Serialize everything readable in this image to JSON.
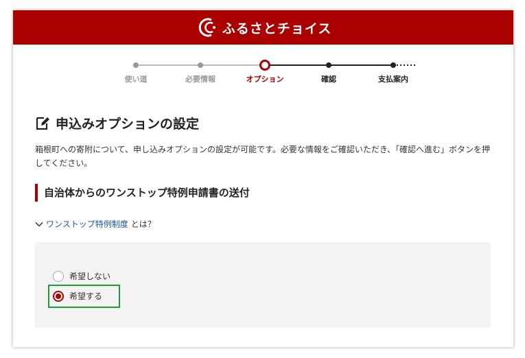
{
  "header": {
    "brand": "ふるさとチョイス",
    "bg_color": "#aa0000"
  },
  "steps": {
    "items": [
      {
        "label": "使い道",
        "state": "done"
      },
      {
        "label": "必要情報",
        "state": "done"
      },
      {
        "label": "オプション",
        "state": "current"
      },
      {
        "label": "確認",
        "state": "upcoming"
      },
      {
        "label": "支払案内",
        "state": "upcoming"
      }
    ]
  },
  "page": {
    "title": "申込みオプションの設定",
    "description": "箱根町への寄附について、申し込みオプションの設定が可能です。必要な情報をご確認いただき、「確認へ進む」ボタンを押してください。"
  },
  "section": {
    "title": "自治体からのワンストップ特例申請書の送付",
    "onestop_link": "ワンストップ特例制度",
    "onestop_suffix": "とは？"
  },
  "options": [
    {
      "label": "希望しない",
      "checked": false
    },
    {
      "label": "希望する",
      "checked": true
    }
  ],
  "colors": {
    "accent": "#aa0000",
    "link": "#1a55a8",
    "highlight": "#1e9a3e"
  }
}
